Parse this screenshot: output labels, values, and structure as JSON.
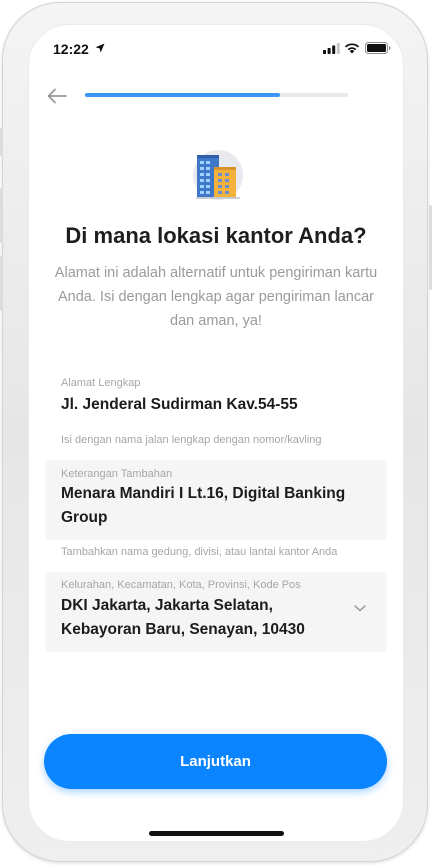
{
  "status_bar": {
    "time": "12:22",
    "icons": [
      "location-arrow-icon",
      "signal-icon",
      "wifi-icon",
      "battery-icon"
    ]
  },
  "header": {
    "back_icon": "arrow-left-icon",
    "progress": 0.74
  },
  "colors": {
    "accent": "#0a84ff",
    "progress": "#3b95f2",
    "title": "#1e1e1e",
    "muted": "#9a9a9a",
    "field_bg": "#f5f5f5"
  },
  "hero": {
    "icon": "office-building-icon",
    "title": "Di mana lokasi kantor Anda?",
    "subtitle": "Alamat ini adalah alternatif untuk pengiriman kartu Anda. Isi dengan lengkap agar pengiriman lancar dan aman, ya!"
  },
  "form": {
    "address": {
      "label": "Alamat Lengkap",
      "value": "Jl. Jenderal Sudirman Kav.54-55",
      "help": "Isi dengan nama jalan lengkap dengan nomor/kavling"
    },
    "extra": {
      "label": "Keterangan Tambahan",
      "value_line1": "Menara Mandiri I Lt.16, Digital Banking",
      "value_line2": "Group",
      "help": "Tambahkan nama gedung, divisi, atau lantai kantor Anda"
    },
    "region": {
      "label": "Kelurahan, Kecamatan, Kota, Provinsi, Kode Pos",
      "value_line1": "DKI Jakarta, Jakarta Selatan,",
      "value_line2": "Kebayoran Baru, Senayan, 10430",
      "icon": "chevron-down-icon"
    }
  },
  "cta": {
    "label": "Lanjutkan"
  }
}
